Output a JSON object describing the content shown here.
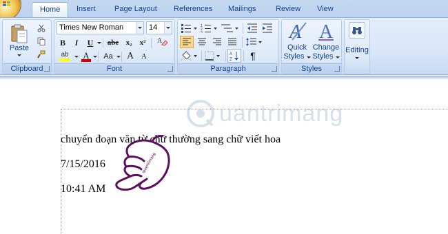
{
  "tabs": [
    {
      "label": "Home",
      "active": true
    },
    {
      "label": "Insert"
    },
    {
      "label": "Page Layout"
    },
    {
      "label": "References"
    },
    {
      "label": "Mailings"
    },
    {
      "label": "Review"
    },
    {
      "label": "View"
    }
  ],
  "clipboard": {
    "label": "Clipboard",
    "paste_label": "Paste"
  },
  "font": {
    "label": "Font",
    "family": "Times New Roman",
    "size": "14",
    "buttons": {
      "bold": "B",
      "italic": "I",
      "underline": "U",
      "strike": "abe",
      "subscript": "x₂",
      "superscript": "x²",
      "change_case": "Aa",
      "grow": "A",
      "shrink": "A",
      "highlight": "ab",
      "color": "A"
    }
  },
  "paragraph": {
    "label": "Paragraph",
    "show_marks": "¶"
  },
  "styles": {
    "label": "Styles",
    "quick_styles": [
      "Quick",
      "Styles"
    ],
    "change_styles": [
      "Change",
      "Styles"
    ]
  },
  "editing": {
    "label": "Editing"
  },
  "document": {
    "lines": [
      "chuyển đoạn văn từ chữ thường sang chữ viết hoa",
      "7/15/2016",
      "10:41 AM"
    ]
  },
  "watermark": {
    "text": "uantrimang"
  },
  "colors": {
    "ribbon": "#dfe9f7",
    "accent": "#15428b",
    "highlight_yellow": "#ffff00",
    "font_red": "#d00000",
    "hand_stroke": "#5b0f5e"
  }
}
